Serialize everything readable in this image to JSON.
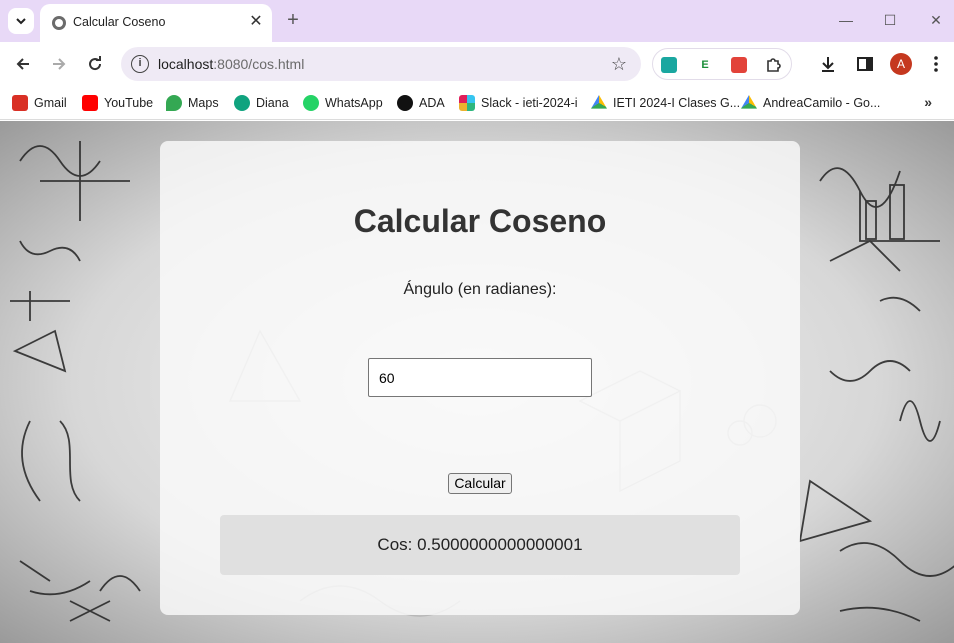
{
  "browser": {
    "tab": {
      "title": "Calcular Coseno"
    },
    "url": {
      "host": "localhost",
      "rest": ":8080/cos.html"
    },
    "avatar_letter": "A",
    "extensions": [
      {
        "icon": "screen-capture-icon",
        "label": "",
        "color": "#1aa7a0"
      },
      {
        "icon": "evernote-icon",
        "label": "E",
        "color": "#1b8f3a"
      },
      {
        "icon": "reader-icon",
        "label": "",
        "color": "#e2433a"
      }
    ]
  },
  "bookmarks": [
    {
      "label": "Gmail",
      "icon": "gmail-icon",
      "color": "#d93025"
    },
    {
      "label": "YouTube",
      "icon": "youtube-icon",
      "color": "#ff0000"
    },
    {
      "label": "Maps",
      "icon": "maps-icon",
      "color": "#34a853"
    },
    {
      "label": "Diana",
      "icon": "openai-icon",
      "color": "#10a37f"
    },
    {
      "label": "WhatsApp",
      "icon": "whatsapp-icon",
      "color": "#25d366"
    },
    {
      "label": "ADA",
      "icon": "ada-icon",
      "color": "#111111"
    },
    {
      "label": "Slack - ieti-2024-i",
      "icon": "slack-icon",
      "color": "#e01e5a"
    },
    {
      "label": "IETI 2024-I Clases G...",
      "icon": "google-drive-icon",
      "color": "#fbbc04"
    },
    {
      "label": "AndreaCamilo - Go...",
      "icon": "google-drive-icon",
      "color": "#fbbc04"
    }
  ],
  "page": {
    "heading": "Calcular Coseno",
    "angle_label": "Ángulo (en radianes):",
    "angle_value": "60",
    "calculate_label": "Calcular",
    "result_text": "Cos: 0.5000000000000001"
  }
}
